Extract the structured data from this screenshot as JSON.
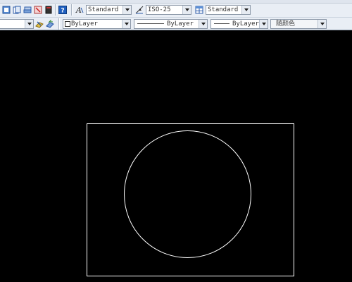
{
  "toolbar_row1": {
    "text_style": "Standard",
    "dim_style": "ISO-25",
    "table_style": "Standard"
  },
  "toolbar_row2": {
    "layer_color": "ByLayer",
    "linetype": "ByLayer",
    "lineweight": "ByLayer",
    "plot_style": "随颜色"
  },
  "colors": {
    "toolbar_bg": "#e9eef5",
    "canvas_bg": "#000000",
    "drawing_stroke": "#ffffff"
  }
}
